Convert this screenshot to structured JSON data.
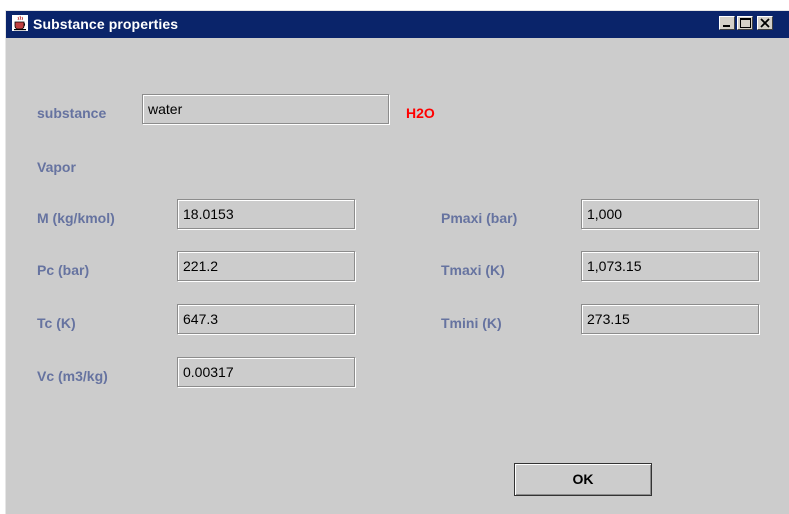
{
  "window": {
    "title": "Substance properties",
    "icon": "java-cup-icon"
  },
  "substance": {
    "label": "substance",
    "value": "water",
    "formula": "H2O"
  },
  "section": {
    "label": "Vapor"
  },
  "fields": {
    "M": {
      "label": "M (kg/kmol)",
      "value": "18.0153"
    },
    "Pc": {
      "label": "Pc (bar)",
      "value": "221.2"
    },
    "Tc": {
      "label": "Tc (K)",
      "value": "647.3"
    },
    "Vc": {
      "label": "Vc (m3/kg)",
      "value": "0.00317"
    },
    "Pmaxi": {
      "label": "Pmaxi (bar)",
      "value": "1,000"
    },
    "Tmaxi": {
      "label": "Tmaxi (K)",
      "value": "1,073.15"
    },
    "Tmini": {
      "label": "Tmini (K)",
      "value": "273.15"
    }
  },
  "buttons": {
    "ok": "OK"
  },
  "colors": {
    "label": "#6673a0",
    "formula": "#ff0000",
    "titlebar": "#0a246a",
    "background": "#cccccc"
  }
}
